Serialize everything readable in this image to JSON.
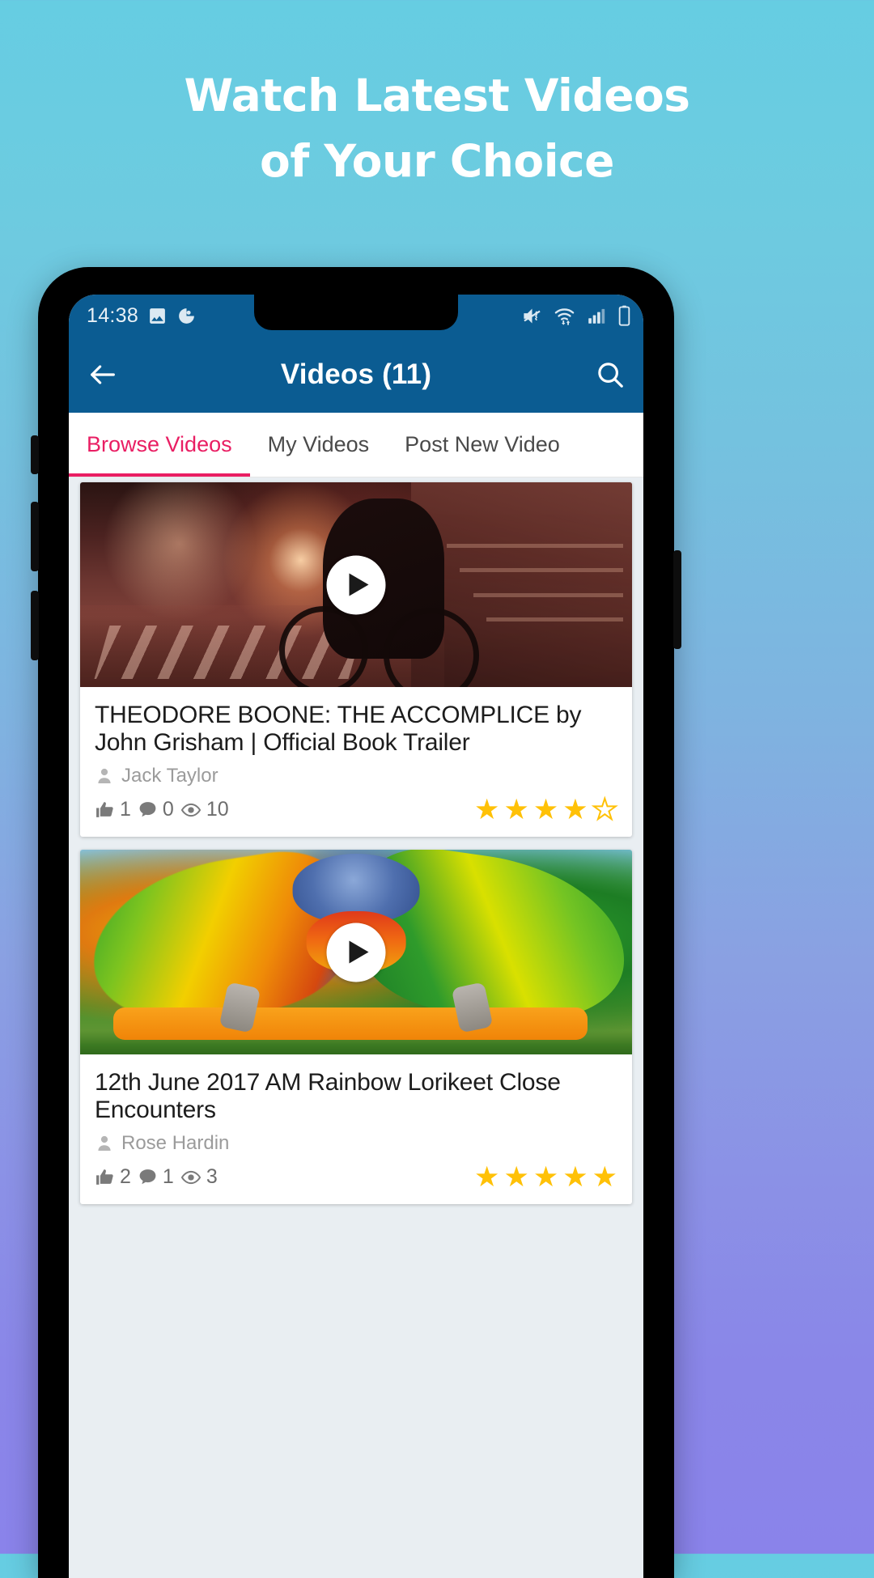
{
  "headline": {
    "line1": "Watch Latest Videos",
    "line2": "of Your Choice"
  },
  "colors": {
    "bg_top": "#66cde2",
    "bg_bottom": "#8a83ea",
    "appbar": "#0b5c92",
    "accent_pink": "#e91e63",
    "star_gold": "#ffc107"
  },
  "status_bar": {
    "time": "14:38",
    "left_icons": [
      "image-icon",
      "app-notification-icon"
    ],
    "right_icons": [
      "vibrate-mute-icon",
      "wifi-icon",
      "signal-bars-icon",
      "battery-icon"
    ]
  },
  "appbar": {
    "back_icon": "back-arrow-icon",
    "title": "Videos (11)",
    "search_icon": "search-icon"
  },
  "tabs": [
    {
      "label": "Browse Videos",
      "active": true
    },
    {
      "label": "My Videos",
      "active": false
    },
    {
      "label": "Post New Video",
      "active": false
    }
  ],
  "videos": [
    {
      "title": "THEODORE BOONE: THE ACCOMPLICE by John Grisham | Official Book Trailer",
      "author": "Jack Taylor",
      "likes": "1",
      "comments": "0",
      "views": "10",
      "rating": 4,
      "rating_max": 5,
      "play_icon": "play-icon"
    },
    {
      "title": "12th June 2017 AM Rainbow Lorikeet Close Encounters",
      "author": "Rose Hardin",
      "likes": "2",
      "comments": "1",
      "views": "3",
      "rating": 5,
      "rating_max": 5,
      "play_icon": "play-icon"
    }
  ]
}
